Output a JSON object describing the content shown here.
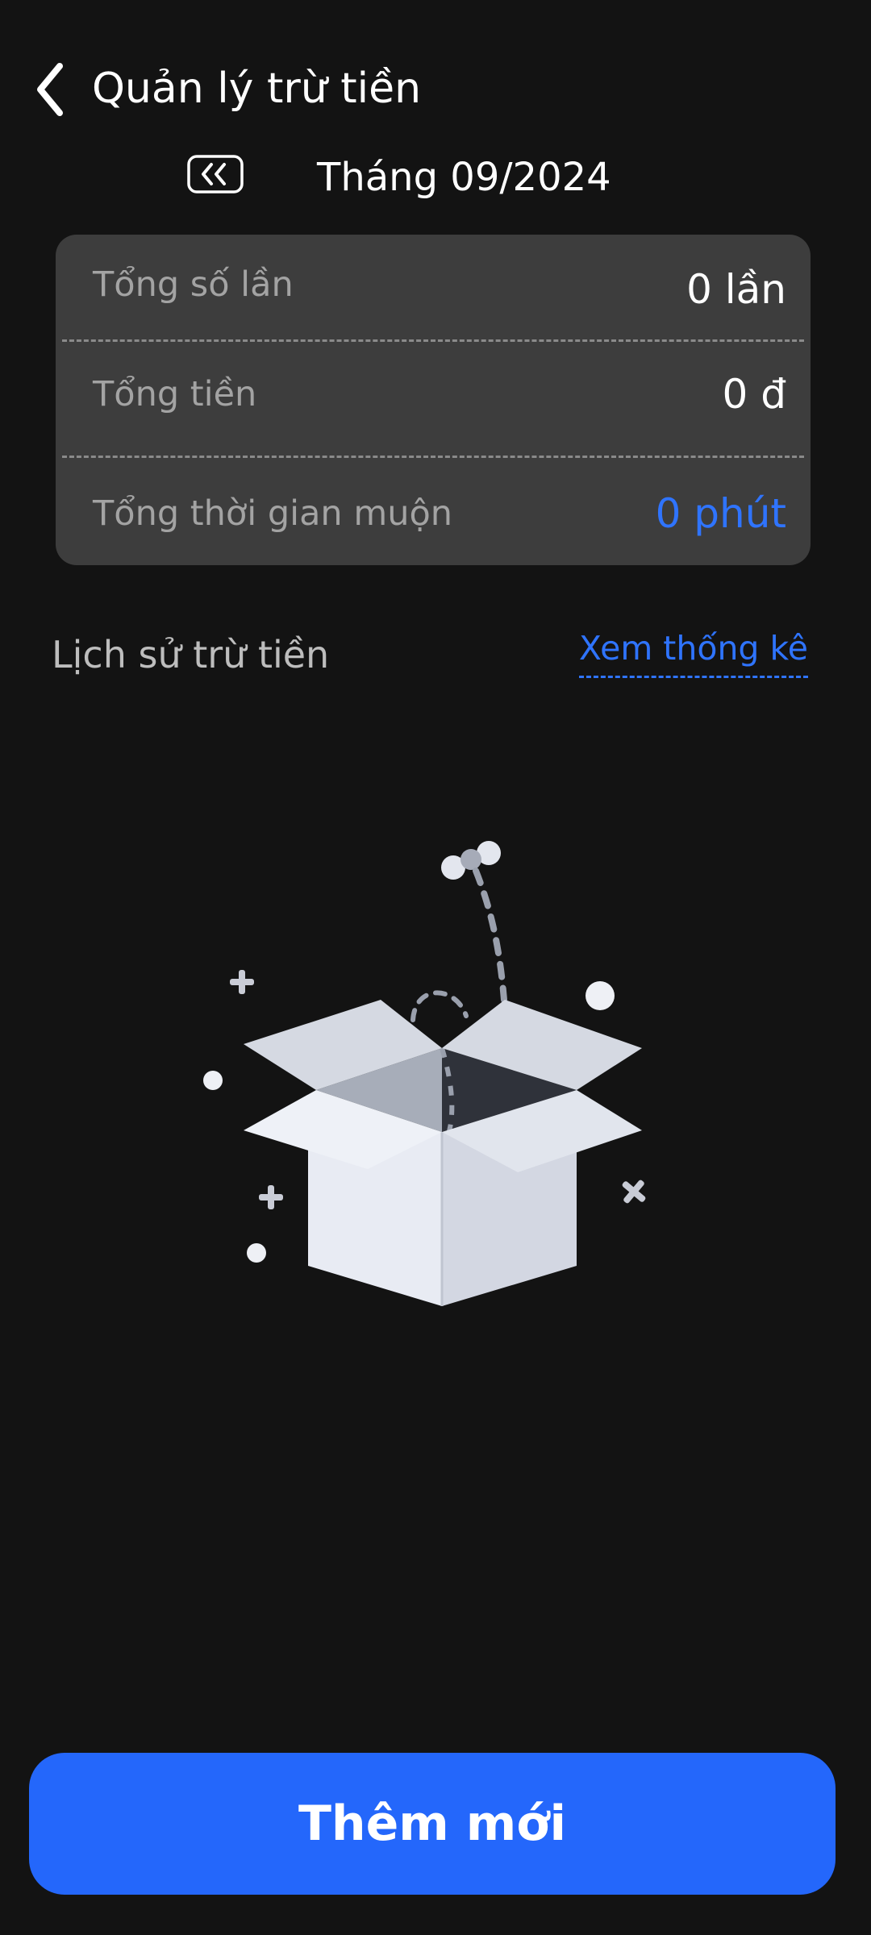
{
  "header": {
    "title": "Quản lý trừ tiền",
    "back_icon": "chevron-left-icon"
  },
  "month_selector": {
    "prev_icon": "double-chevron-left-icon",
    "label": "Tháng 09/2024"
  },
  "summary": {
    "rows": [
      {
        "label": "Tổng số lần",
        "value": "0 lần"
      },
      {
        "label": "Tổng tiền",
        "value": "0 đ"
      },
      {
        "label": "Tổng thời gian muộn",
        "value": "0 phút"
      }
    ]
  },
  "history": {
    "title": "Lịch sử trừ tiền",
    "view_stats_label": "Xem thống kê"
  },
  "empty_state": {
    "icon": "open-box-illustration"
  },
  "actions": {
    "add_label": "Thêm mới"
  },
  "colors": {
    "background": "#131313",
    "card": "#3d3d3d",
    "accent": "#2467fb",
    "accent_text": "#2f74ff"
  }
}
